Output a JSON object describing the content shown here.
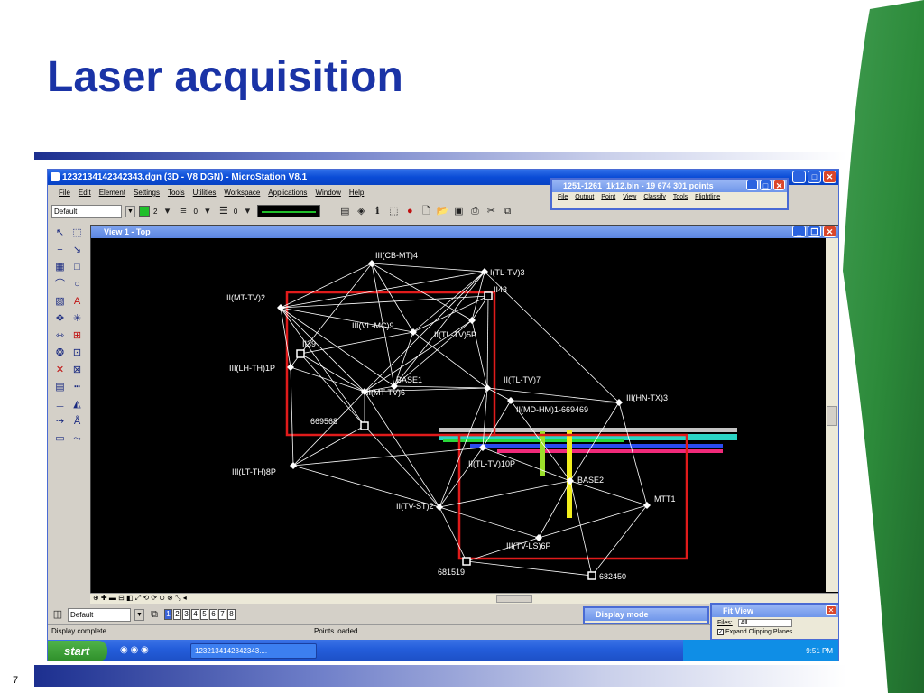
{
  "slide": {
    "title": "Laser acquisition",
    "page_number": "7"
  },
  "microstation": {
    "window_title": "1232134142342343.dgn (3D - V8 DGN) - MicroStation V8.1",
    "menu": [
      "File",
      "Edit",
      "Element",
      "Settings",
      "Tools",
      "Utilities",
      "Workspace",
      "Applications",
      "Window",
      "Help"
    ],
    "toolbar": {
      "level": "Default",
      "color_index": "2",
      "style_index": "0",
      "weight_index": "0"
    },
    "view_title": "View 1 - Top",
    "view_group": "Default",
    "view_numbers": [
      "1",
      "2",
      "3",
      "4",
      "5",
      "6",
      "7",
      "8"
    ],
    "status_left": "Display complete",
    "status_right": "Points loaded"
  },
  "terrascan_window": {
    "title": "1251-1261_1k12.bin - 19 674 301 points",
    "menu": [
      "File",
      "Output",
      "Point",
      "View",
      "Classify",
      "Tools",
      "Flightline"
    ]
  },
  "fit_view": {
    "title": "Fit View",
    "files_label": "Files:",
    "files_value": "All",
    "checkbox_label": "Expand Clipping Planes"
  },
  "display_mode": {
    "title": "Display mode"
  },
  "taskbar": {
    "start_label": "start",
    "task_item": "1232134142342343....",
    "clock": "9:51 PM"
  },
  "survey_points": [
    {
      "id": "cb_mt4",
      "label": "III(CB-MT)4"
    },
    {
      "id": "tl_tv3",
      "label": "I(TL-TV)3"
    },
    {
      "id": "mt_tv2",
      "label": "II(MT-TV)2"
    },
    {
      "id": "p43",
      "label": "II43"
    },
    {
      "id": "vl_mc9",
      "label": "III(VL-MC)9"
    },
    {
      "id": "tl_tv5p",
      "label": "II(TL-TV)5P"
    },
    {
      "id": "p39",
      "label": "II39"
    },
    {
      "id": "lh_th1p",
      "label": "III(LH-TH)1P"
    },
    {
      "id": "base1",
      "label": "BASE1"
    },
    {
      "id": "mt_tv6",
      "label": "II(MT-TV)6"
    },
    {
      "id": "tl_tv7",
      "label": "II(TL-TV)7"
    },
    {
      "id": "hn_tx3",
      "label": "III(HN-TX)3"
    },
    {
      "id": "md_hm1",
      "label": "II(MD-HM)1-669469"
    },
    {
      "id": "p669568",
      "label": "669568"
    },
    {
      "id": "tl_tv10p",
      "label": "II(TL-TV)10P"
    },
    {
      "id": "lt_th8p",
      "label": "III(LT-TH)8P"
    },
    {
      "id": "base2",
      "label": "BASE2"
    },
    {
      "id": "tv_st2",
      "label": "II(TV-ST)2"
    },
    {
      "id": "mtt1",
      "label": "MTT1"
    },
    {
      "id": "tv_ls6p",
      "label": "III(TV-LS)6P"
    },
    {
      "id": "p681519",
      "label": "681519"
    },
    {
      "id": "p682450",
      "label": "682450"
    }
  ],
  "colors": {
    "title_blue": "#1a33a6",
    "selection_red": "#e01b1b",
    "xp_blue": "#0a4bd6",
    "green_accent": "#2c8a3a"
  }
}
